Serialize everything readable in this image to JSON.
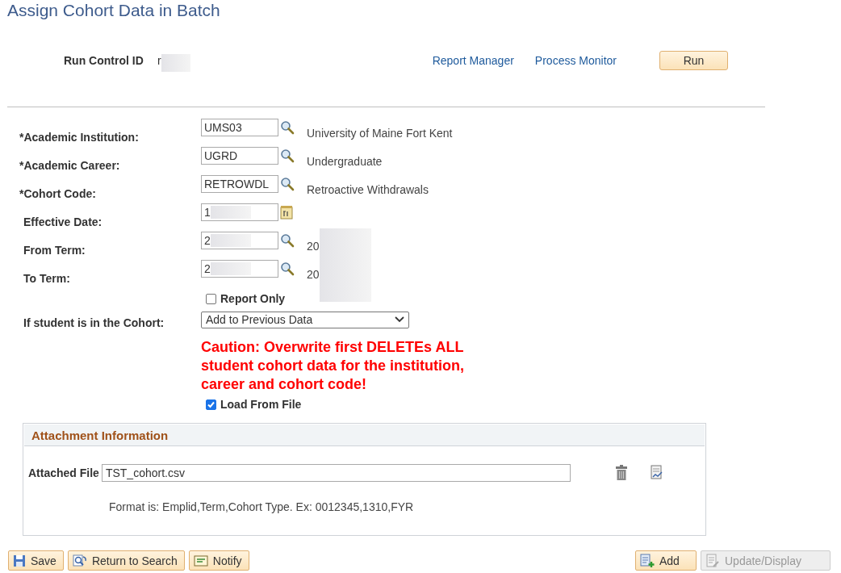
{
  "page_title": "Assign Cohort Data in Batch",
  "run_control": {
    "label": "Run Control ID",
    "value": "r"
  },
  "links": [
    "Report Manager",
    "Process Monitor"
  ],
  "run_button": "Run",
  "fields": [
    {
      "kind": "lookup",
      "label": "*Academic Institution:",
      "value": "UMS03",
      "description": "University of Maine Fort Kent",
      "redacted": false
    },
    {
      "kind": "lookup",
      "label": "*Academic Career:",
      "value": "UGRD",
      "description": "Undergraduate",
      "redacted": false
    },
    {
      "kind": "lookup",
      "label": "*Cohort Code:",
      "value": "RETROWDL",
      "description": "Retroactive Withdrawals",
      "redacted": false
    },
    {
      "kind": "date",
      "label": "Effective Date:",
      "value": "1",
      "redacted": true
    },
    {
      "kind": "lookup",
      "label": "From Term:",
      "value": "2",
      "description": "20",
      "redacted": true
    },
    {
      "kind": "lookup",
      "label": "To Term:",
      "value": "2",
      "description": "20",
      "redacted": true
    }
  ],
  "report_only": {
    "label": "Report Only",
    "checked": false
  },
  "cohort_option": {
    "label": "If student is in the Cohort:",
    "value": "Add to Previous Data"
  },
  "caution": "Caution: Overwrite first DELETEs ALL student cohort data for the institution, career and cohort code!",
  "load_from_file": {
    "label": "Load From File",
    "checked": true
  },
  "attachment": {
    "title": "Attachment Information",
    "file_label": "Attached File",
    "file_value": "TST_cohort.csv",
    "format_note": "Format is: Emplid,Term,Cohort Type. Ex: 0012345,1310,FYR"
  },
  "footer_buttons": [
    {
      "kind": "save",
      "label": "Save",
      "disabled": false
    },
    {
      "kind": "search",
      "label": "Return to Search",
      "disabled": false
    },
    {
      "kind": "notify",
      "label": "Notify",
      "disabled": false
    },
    {
      "kind": "add",
      "label": "Add",
      "disabled": false
    },
    {
      "kind": "update",
      "label": "Update/Display",
      "disabled": true
    }
  ]
}
